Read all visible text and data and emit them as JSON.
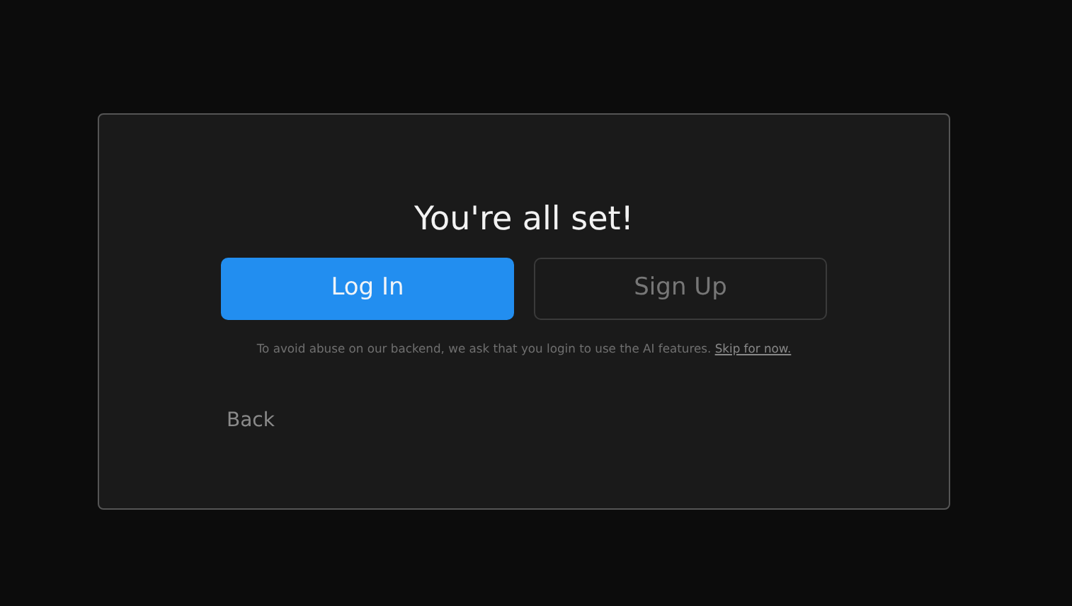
{
  "dialog": {
    "title": "You're all set!",
    "buttons": [
      {
        "label": "Log In",
        "kind": "primary"
      },
      {
        "label": "Sign Up",
        "kind": "outline"
      }
    ],
    "notice": "To avoid abuse on our backend, we ask that you login to use the AI features.",
    "skip_link": "Skip for now.",
    "back": "Back"
  }
}
